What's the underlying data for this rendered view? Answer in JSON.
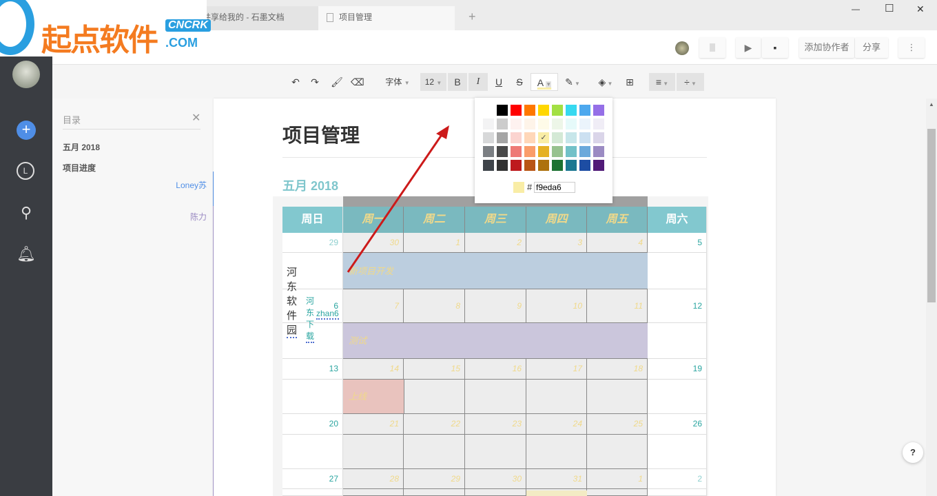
{
  "watermark": {
    "text": "起点软件",
    "sub": "CNCRK",
    ".com": ".COM"
  },
  "tabs": [
    {
      "label": "共享给我的 - 石墨文档"
    },
    {
      "label": "项目管理"
    }
  ],
  "window": {
    "new_tab": "+",
    "minimize": "—",
    "maximize": "☐",
    "close": "✕"
  },
  "topbar": {
    "add_collaborator": "添加协作者",
    "share": "分享",
    "more": "⋮"
  },
  "toolbar": {
    "font": "字体",
    "size": "12",
    "bold": "B",
    "italic": "I",
    "underline": "U",
    "strike": "S",
    "text_color": "A"
  },
  "toc": {
    "title": "目录",
    "items": [
      {
        "label": "五月 2018"
      },
      {
        "label": "项目进度"
      },
      {
        "label": "Loney苏"
      },
      {
        "label": "陈力"
      }
    ]
  },
  "doc": {
    "title": "项目管理",
    "heading": "五月 2018"
  },
  "calendar": {
    "headers": [
      "周日",
      "周一",
      "周二",
      "周三",
      "周四",
      "周五",
      "周六"
    ],
    "weeks": [
      [
        "29",
        "30",
        "1",
        "2",
        "3",
        "4",
        "5"
      ],
      [
        "6",
        "7",
        "8",
        "9",
        "10",
        "11",
        "12"
      ],
      [
        "13",
        "14",
        "15",
        "16",
        "17",
        "18",
        "19"
      ],
      [
        "20",
        "21",
        "22",
        "23",
        "24",
        "25",
        "26"
      ],
      [
        "27",
        "28",
        "29",
        "30",
        "31",
        "1",
        "2"
      ]
    ],
    "events": {
      "e1": "新项目开发",
      "e2": "测试",
      "e3": "上线",
      "sun1": "河东软件园",
      "sun2a": "河东下载",
      "sun2b": "zhan6"
    }
  },
  "palette": {
    "hex_label": "#",
    "hex_value": "f9eda6",
    "selected": "#f9eda6",
    "rows": [
      [
        "#ffffff",
        "#000000",
        "#ff0000",
        "#ff7800",
        "#ffd700",
        "#a3e043",
        "#37d9f0",
        "#4da8ee",
        "#956fe7"
      ],
      [
        "#f3f3f4",
        "#cccccc",
        "#fef2f0",
        "#fef4e9",
        "#fefbe8",
        "#edf6e8",
        "#e6fafa",
        "#ebf4fc",
        "#f0edf6"
      ],
      [
        "#d7d8d9",
        "#a5a5a5",
        "#fbd4d0",
        "#ffd7b9",
        "#f9eda6",
        "#d4e9d6",
        "#c7e6ea",
        "#cce0f1",
        "#dad5e9"
      ],
      [
        "#7b7f83",
        "#494949",
        "#ee7976",
        "#fa9d6a",
        "#e5b123",
        "#97c28f",
        "#72c1c8",
        "#6ba9db",
        "#9b8bc3"
      ],
      [
        "#3e4349",
        "#313131",
        "#be1a1d",
        "#b95514",
        "#ad720e",
        "#1c7231",
        "#1c7892",
        "#1d4da3",
        "#511b78"
      ]
    ]
  },
  "colors": {
    "header_weekend": "#82c8cf",
    "header_weekday": "#7ab9bf",
    "weekday_text": "#f0d98a",
    "event1": "#bccedf",
    "event2": "#cbc6dc",
    "event3": "#e9c3be",
    "accent_blue": "#4f8ee6"
  }
}
